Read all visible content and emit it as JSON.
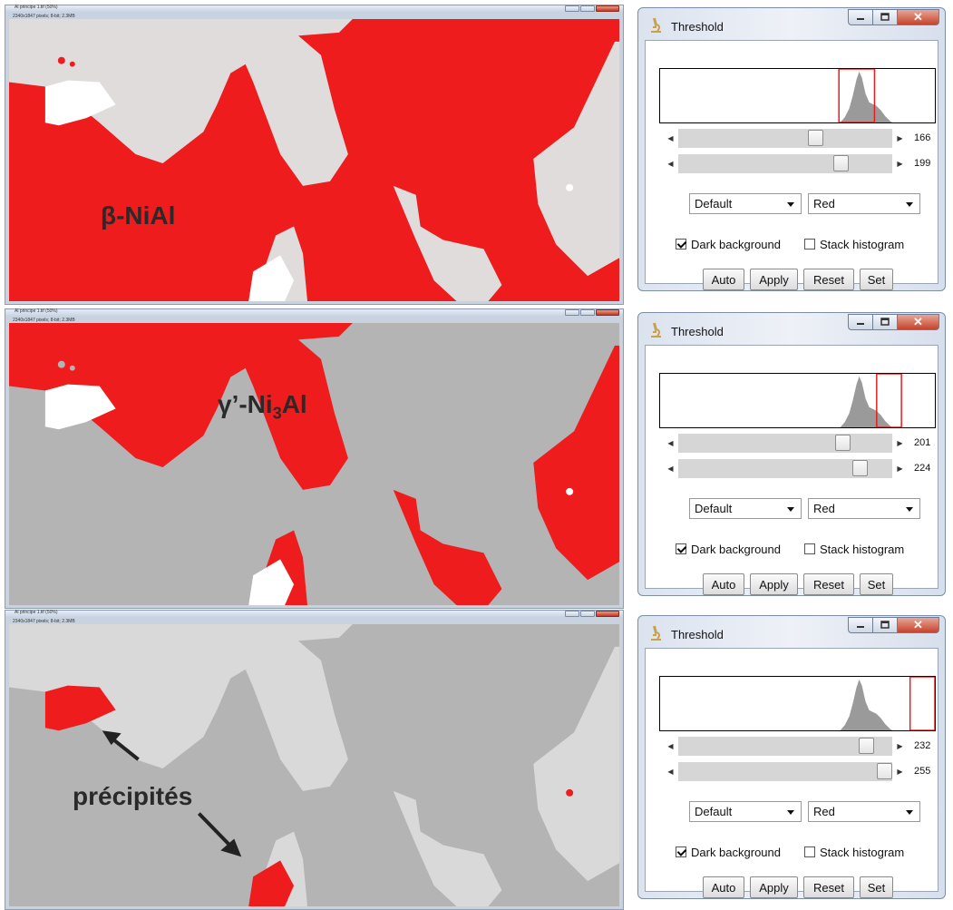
{
  "image_windows": [
    {
      "title": "Al principe 1.tif (50%)",
      "info": "2340x1847 pixels; 8-bit; 2.3MB",
      "phase_label": "β-NiAl"
    },
    {
      "title": "Al principe 1.tif (50%)",
      "info": "2340x1847 pixels; 8-bit; 2.3MB",
      "phase_label_main": "γ’-Ni",
      "phase_label_sub": "3",
      "phase_label_end": "Al"
    },
    {
      "title": "Al principe 1.tif (50%)",
      "info": "2340x1847 pixels; 8-bit; 2.3MB",
      "phase_label": "précipités"
    }
  ],
  "threshold_dialogs": [
    {
      "title": "Threshold",
      "min": 166,
      "max": 199,
      "min_label": "166",
      "max_label": "199",
      "method": "Default",
      "display": "Red",
      "dark_background_label": "Dark background",
      "dark_background": true,
      "stack_histogram_label": "Stack histogram",
      "stack_histogram": false,
      "buttons": {
        "auto": "Auto",
        "apply": "Apply",
        "reset": "Reset",
        "set": "Set"
      }
    },
    {
      "title": "Threshold",
      "min": 201,
      "max": 224,
      "min_label": "201",
      "max_label": "224",
      "method": "Default",
      "display": "Red",
      "dark_background_label": "Dark background",
      "dark_background": true,
      "stack_histogram_label": "Stack histogram",
      "stack_histogram": false,
      "buttons": {
        "auto": "Auto",
        "apply": "Apply",
        "reset": "Reset",
        "set": "Set"
      }
    },
    {
      "title": "Threshold",
      "min": 232,
      "max": 255,
      "min_label": "232",
      "max_label": "255",
      "method": "Default",
      "display": "Red",
      "dark_background_label": "Dark background",
      "dark_background": true,
      "stack_histogram_label": "Stack histogram",
      "stack_histogram": false,
      "buttons": {
        "auto": "Auto",
        "apply": "Apply",
        "reset": "Reset",
        "set": "Set"
      }
    }
  ],
  "colors": {
    "threshold_red": "#ee1c1c",
    "matrix_gray": "#b4b4b4",
    "light_phase": "#e2e2e2",
    "precipitate_white": "#ffffff",
    "histogram_gray": "#9a9a9a"
  }
}
